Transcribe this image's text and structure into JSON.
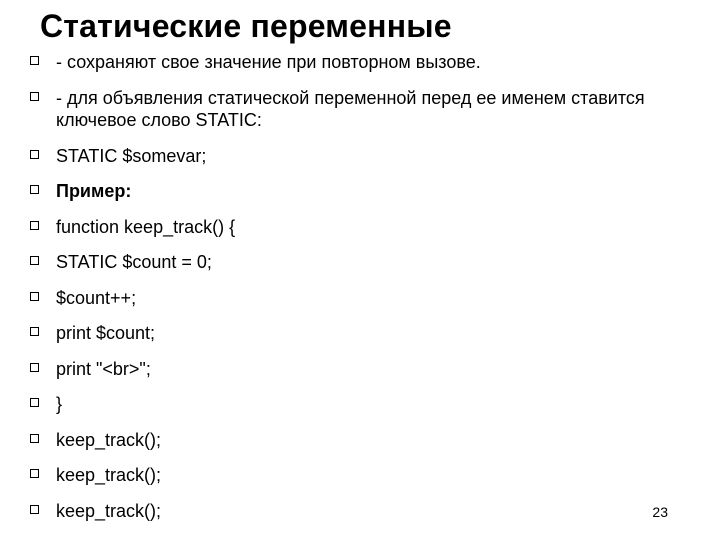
{
  "title": "Статические переменные",
  "bullets": [
    {
      "text": "- сохраняют свое значение при повторном вызове.",
      "bold": false
    },
    {
      "text": "- для объявления статической переменной перед ее именем ставится ключевое слово STATIC:",
      "bold": false
    },
    {
      "text": "STATIC $somevar;",
      "bold": false
    },
    {
      "text": "Пример:",
      "bold": true
    },
    {
      "text": "function keep_track() {",
      "bold": false
    },
    {
      "text": "STATIC $count = 0;",
      "bold": false
    },
    {
      "text": "$count++;",
      "bold": false
    },
    {
      "text": "print $count;",
      "bold": false
    },
    {
      "text": "print \"<br>\";",
      "bold": false
    },
    {
      "text": "}",
      "bold": false
    },
    {
      "text": "keep_track();",
      "bold": false
    },
    {
      "text": "keep_track();",
      "bold": false
    },
    {
      "text": "keep_track();",
      "bold": false
    }
  ],
  "page_number": "23"
}
